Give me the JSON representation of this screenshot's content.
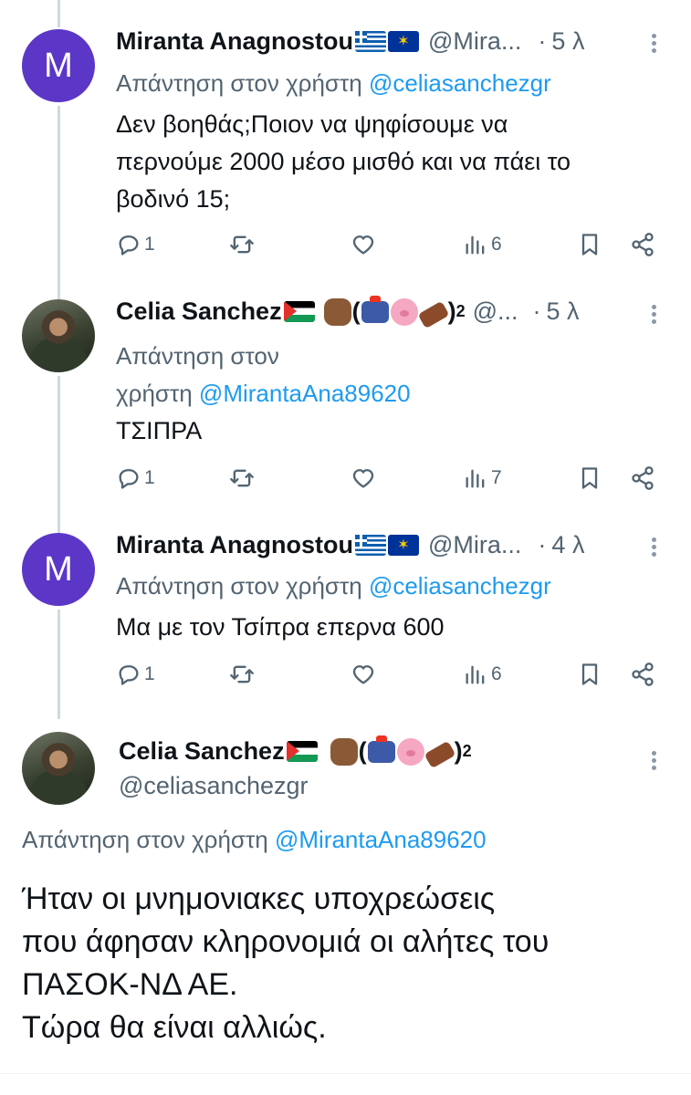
{
  "tweets": [
    {
      "name": "Miranta Anagnostou",
      "handle": "@Mira...",
      "dot": "·",
      "time": "5 λ",
      "avatar_letter": "M",
      "reply_prefix": "Απάντηση στον χρήστη",
      "reply_mention": "@celiasanchezgr",
      "lines": [
        "Δεν βοηθάς;Ποιον να ψηφίσουμε να",
        "περνούμε 2000 μέσο μισθό και να πάει το",
        "βοδινό 15;"
      ],
      "replies": "1",
      "views": "6"
    },
    {
      "name": "Celia Sanchez",
      "handle": "@...",
      "dot": "·",
      "time": "5 λ",
      "reply_prefix_1": "Απάντηση στον",
      "reply_prefix_2": "χρήστη",
      "reply_mention": "@MirantaAna89620",
      "lines": [
        "ΤΣΙΠΡΑ"
      ],
      "replies": "1",
      "views": "7"
    },
    {
      "name": "Miranta Anagnostou",
      "handle": "@Mira...",
      "dot": "·",
      "time": "4 λ",
      "avatar_letter": "M",
      "reply_prefix": "Απάντηση στον χρήστη",
      "reply_mention": "@celiasanchezgr",
      "lines": [
        "Μα με τον Τσίπρα επερνα 600"
      ],
      "replies": "1",
      "views": "6"
    }
  ],
  "main": {
    "name": "Celia Sanchez",
    "handle": "@celiasanchezgr",
    "reply_prefix": "Απάντηση στον χρήστη",
    "reply_mention": "@MirantaAna89620",
    "lines": [
      "Ήταν οι μνημονιακες υποχρεώσεις",
      "που άφησαν κληρονομιά οι αλήτες του",
      "ΠΑΣΟΚ-ΝΔ ΑΕ.",
      "Τώρα θα είναι αλλιώς."
    ]
  },
  "decor": {
    "paren_open": "(",
    "paren_close": ")",
    "superscript": "2"
  }
}
